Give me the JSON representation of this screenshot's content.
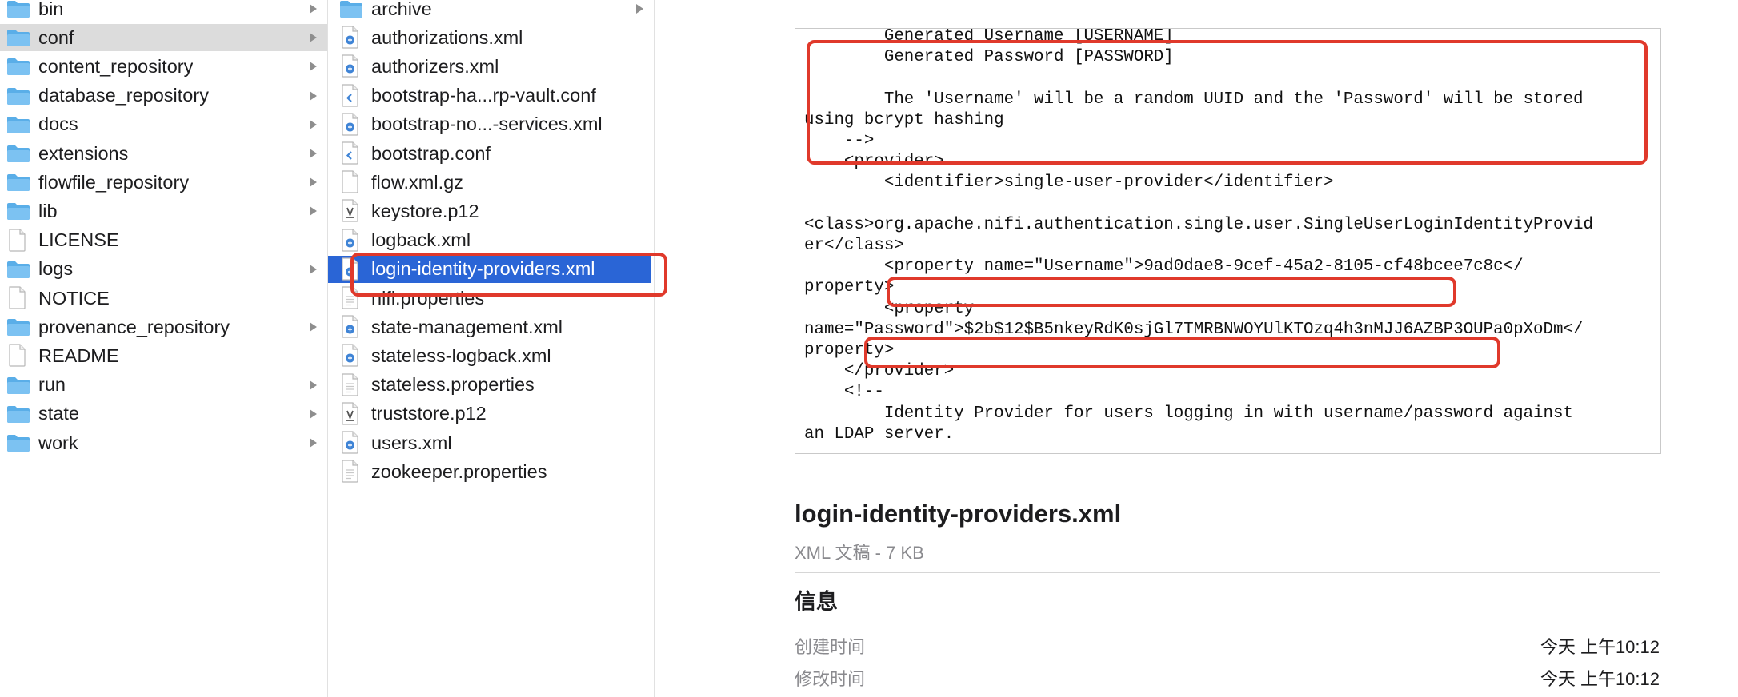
{
  "sidebar": {
    "items": [
      {
        "label": "bin",
        "icon": "folder-icon",
        "chevron": true
      },
      {
        "label": "conf",
        "icon": "folder-icon",
        "chevron": true,
        "selected": true
      },
      {
        "label": "content_repository",
        "icon": "folder-icon",
        "chevron": true
      },
      {
        "label": "database_repository",
        "icon": "folder-icon",
        "chevron": true
      },
      {
        "label": "docs",
        "icon": "folder-icon",
        "chevron": true
      },
      {
        "label": "extensions",
        "icon": "folder-icon",
        "chevron": true
      },
      {
        "label": "flowfile_repository",
        "icon": "folder-icon",
        "chevron": true
      },
      {
        "label": "lib",
        "icon": "folder-icon",
        "chevron": true
      },
      {
        "label": "LICENSE",
        "icon": "document-icon",
        "chevron": false
      },
      {
        "label": "logs",
        "icon": "folder-icon",
        "chevron": true
      },
      {
        "label": "NOTICE",
        "icon": "document-icon",
        "chevron": false
      },
      {
        "label": "provenance_repository",
        "icon": "folder-icon",
        "chevron": true
      },
      {
        "label": "README",
        "icon": "document-icon",
        "chevron": false
      },
      {
        "label": "run",
        "icon": "folder-icon",
        "chevron": true
      },
      {
        "label": "state",
        "icon": "folder-icon",
        "chevron": true
      },
      {
        "label": "work",
        "icon": "folder-icon",
        "chevron": true
      }
    ]
  },
  "files": {
    "items": [
      {
        "label": "archive",
        "icon": "folder-icon",
        "chevron": true
      },
      {
        "label": "authorizations.xml",
        "icon": "xml-file-icon"
      },
      {
        "label": "authorizers.xml",
        "icon": "xml-file-icon"
      },
      {
        "label": "bootstrap-ha...rp-vault.conf",
        "icon": "code-file-icon"
      },
      {
        "label": "bootstrap-no...-services.xml",
        "icon": "xml-file-icon"
      },
      {
        "label": "bootstrap.conf",
        "icon": "code-file-icon"
      },
      {
        "label": "flow.xml.gz",
        "icon": "blank-file-icon"
      },
      {
        "label": "keystore.p12",
        "icon": "certificate-file-icon"
      },
      {
        "label": "logback.xml",
        "icon": "xml-file-icon"
      },
      {
        "label": "login-identity-providers.xml",
        "icon": "xml-file-icon",
        "selected": true
      },
      {
        "label": "nifi.properties",
        "icon": "text-file-icon"
      },
      {
        "label": "state-management.xml",
        "icon": "xml-file-icon"
      },
      {
        "label": "stateless-logback.xml",
        "icon": "xml-file-icon"
      },
      {
        "label": "stateless.properties",
        "icon": "text-file-icon"
      },
      {
        "label": "truststore.p12",
        "icon": "certificate-file-icon"
      },
      {
        "label": "users.xml",
        "icon": "xml-file-icon"
      },
      {
        "label": "zookeeper.properties",
        "icon": "text-file-icon"
      }
    ]
  },
  "preview": {
    "xml_lines": [
      "        Generated Username [USERNAME]",
      "        Generated Password [PASSWORD]",
      "",
      "        The 'Username' will be a random UUID and the 'Password' will be stored",
      "using bcrypt hashing",
      "    -->",
      "    <provider>",
      "        <identifier>single-user-provider</identifier>",
      "",
      "<class>org.apache.nifi.authentication.single.user.SingleUserLoginIdentityProvid",
      "er</class>",
      "        <property name=\"Username\">9ad0dae8-9cef-45a2-8105-cf48bcee7c8c</",
      "property>",
      "        <property",
      "name=\"Password\">$2b$12$B5nkeyRdK0sjGl7TMRBNWOYUlKTOzq4h3nMJJ6AZBP3OUPa0pXoDm</",
      "property>",
      "    </provider>",
      "    <!--",
      "        Identity Provider for users logging in with username/password against",
      "an LDAP server."
    ],
    "file_name": "login-identity-providers.xml",
    "file_kind": "XML 文稿 - 7 KB",
    "info_heading": "信息",
    "created_label": "创建时间",
    "created_value": "今天 上午10:12",
    "modified_label": "修改时间",
    "modified_value": "今天 上午10:12"
  },
  "colors": {
    "folder": "#5aaee8",
    "selection_blue": "#2a65d6",
    "selection_gray": "#dcdcdc",
    "annotation_red": "#e0392b"
  }
}
